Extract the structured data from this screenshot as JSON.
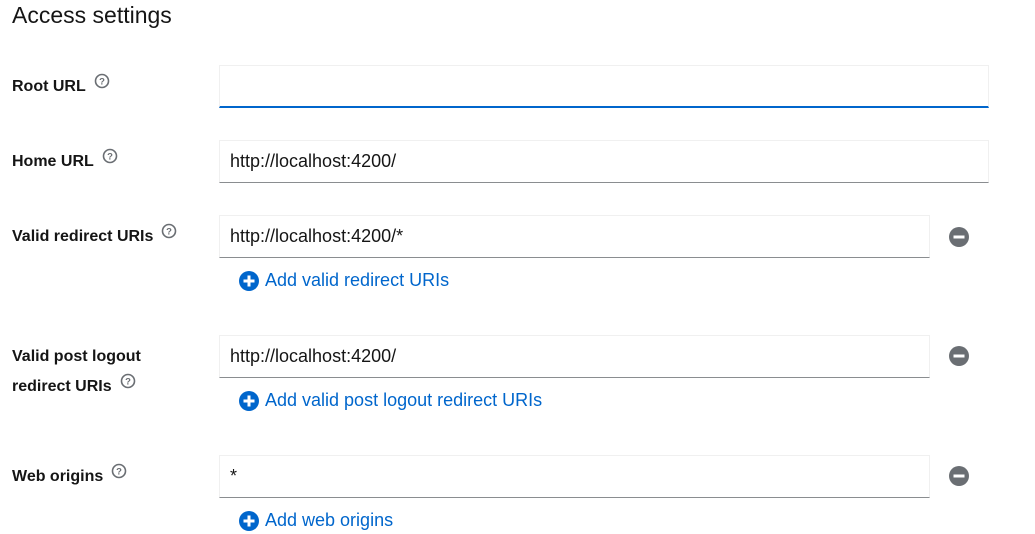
{
  "section_title": "Access settings",
  "fields": {
    "root_url": {
      "label": "Root URL",
      "value": ""
    },
    "home_url": {
      "label": "Home URL",
      "value": "http://localhost:4200/"
    },
    "redirect_uris": {
      "label": "Valid redirect URIs",
      "value": "http://localhost:4200/*",
      "add_label": "Add valid redirect URIs"
    },
    "post_logout": {
      "label_line1": "Valid post logout",
      "label_line2": "redirect URIs",
      "value": "http://localhost:4200/",
      "add_label": "Add valid post logout redirect URIs"
    },
    "web_origins": {
      "label": "Web origins",
      "value": "*",
      "add_label": "Add web origins"
    }
  },
  "colors": {
    "link": "#0066cc",
    "icon_gray": "#6a6e73"
  }
}
